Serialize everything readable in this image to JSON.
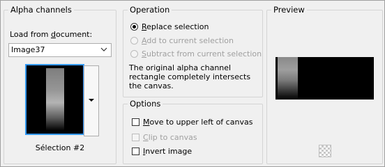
{
  "alpha_channels": {
    "title": "Alpha channels",
    "load_label_pre": "Load from ",
    "load_label_key": "d",
    "load_label_post": "ocument:",
    "document_value": "Image37",
    "selection_label": "Sélection #2"
  },
  "operation": {
    "title": "Operation",
    "options": [
      {
        "key": "R",
        "rest": "eplace selection",
        "checked": true,
        "enabled": true
      },
      {
        "key": "A",
        "rest": "dd to current selection",
        "checked": false,
        "enabled": false
      },
      {
        "key": "S",
        "rest": "ubtract from current selection",
        "checked": false,
        "enabled": false
      }
    ],
    "message": "The original alpha channel rectangle completely intersects the canvas."
  },
  "options": {
    "title": "Options",
    "items": [
      {
        "key": "M",
        "rest": "ove to upper left of canvas",
        "checked": false,
        "enabled": true
      },
      {
        "key": "C",
        "rest": "lip to canvas",
        "checked": false,
        "enabled": false
      },
      {
        "key": "I",
        "rest": "nvert image",
        "checked": false,
        "enabled": true
      }
    ]
  },
  "preview": {
    "title": "Preview",
    "transparency_icon": "checkerboard-icon"
  },
  "colors": {
    "selection_border": "#3399ff",
    "background": "#f0f0f0"
  }
}
